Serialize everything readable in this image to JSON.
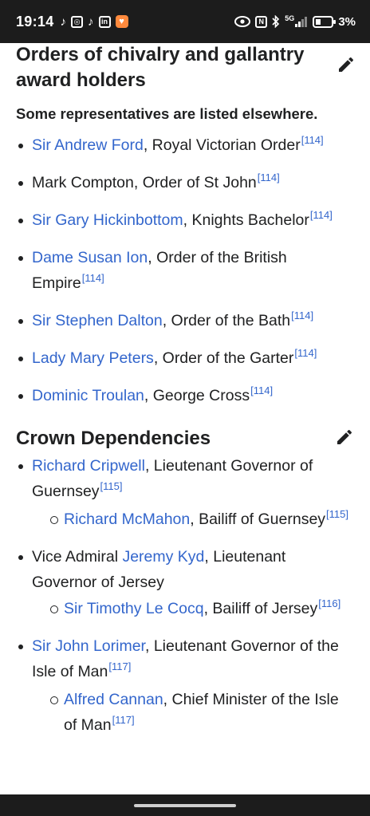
{
  "status_bar": {
    "time": "19:14",
    "left_icons": [
      "tiktok-icon",
      "instagram-icon",
      "tiktok-icon",
      "linkedin-icon",
      "app-heart-icon"
    ],
    "network": "5G",
    "battery": "3%"
  },
  "section1": {
    "title": "Orders of chivalry and gallantry award holders",
    "note": "Some representatives are listed elsewhere.",
    "items": [
      {
        "link": "Sir Andrew Ford",
        "text": ", Royal Victorian Order",
        "ref": "[114]"
      },
      {
        "link": "",
        "text": "Mark Compton, Order of St John",
        "ref": "[114]"
      },
      {
        "link": "Sir Gary Hickinbottom",
        "text": ", Knights Bachelor",
        "ref": "[114]"
      },
      {
        "link": "Dame Susan Ion",
        "text": ", Order of the British Empire",
        "ref": "[114]"
      },
      {
        "link": "Sir Stephen Dalton",
        "text": ", Order of the Bath",
        "ref": "[114]"
      },
      {
        "link": "Lady Mary Peters",
        "text": ", Order of the Garter",
        "ref": "[114]"
      },
      {
        "link": "Dominic Troulan",
        "text": ", George Cross",
        "ref": "[114]"
      }
    ]
  },
  "section2": {
    "title": "Crown Dependencies",
    "items": [
      {
        "prefix": "",
        "link": "Richard Cripwell",
        "text": ", Lieutenant Governor of Guernsey",
        "ref": "[115]",
        "sub": {
          "link": "Richard McMahon",
          "text": ", Bailiff of Guernsey",
          "ref": "[115]"
        }
      },
      {
        "prefix": "Vice Admiral ",
        "link": "Jeremy Kyd",
        "text": ", Lieutenant Governor of Jersey",
        "ref": "",
        "sub": {
          "link": "Sir Timothy Le Cocq",
          "text": ", Bailiff of Jersey",
          "ref": "[116]"
        }
      },
      {
        "prefix": "",
        "link": "Sir John Lorimer",
        "text": ", Lieutenant Governor of the Isle of Man",
        "ref": "[117]",
        "sub": {
          "link": "Alfred Cannan",
          "text": ", Chief Minister of the Isle of Man",
          "ref": "[117]"
        }
      }
    ]
  },
  "colors": {
    "link": "#3366cc",
    "text": "#202122",
    "status_bar_bg": "#1c1c1c"
  }
}
